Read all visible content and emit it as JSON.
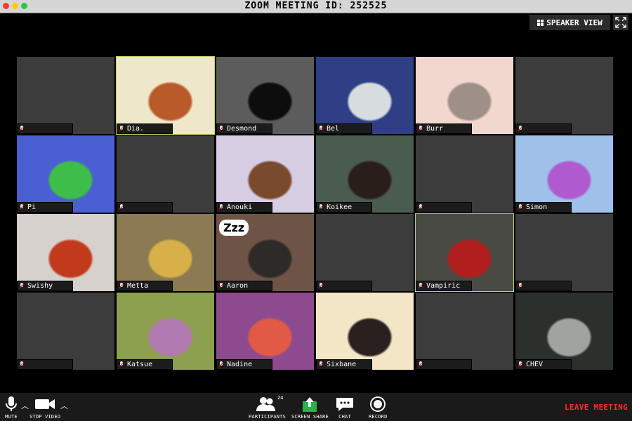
{
  "window": {
    "title": "ZOOM MEETING ID: 252525"
  },
  "top_controls": {
    "speaker_view_label": "SPEAKER VIEW"
  },
  "participants": [
    {
      "name": "",
      "has_video": false
    },
    {
      "name": "Dia.",
      "has_video": true,
      "bg": "#efe7c9",
      "fg": "#b85a2a",
      "active": true
    },
    {
      "name": "Desmond",
      "has_video": true,
      "bg": "#5c5c5c",
      "fg": "#0d0d0d"
    },
    {
      "name": "Bel",
      "has_video": true,
      "bg": "#2f3f86",
      "fg": "#d7dcde"
    },
    {
      "name": "Burr",
      "has_video": true,
      "bg": "#f1d7cd",
      "fg": "#9e9088"
    },
    {
      "name": "",
      "has_video": false
    },
    {
      "name": "Pi",
      "has_video": true,
      "bg": "#4a5fd1",
      "fg": "#3fbd4a"
    },
    {
      "name": "",
      "has_video": false
    },
    {
      "name": "Anouki",
      "has_video": true,
      "bg": "#d7cde3",
      "fg": "#7a4a2e"
    },
    {
      "name": "Koikee",
      "has_video": true,
      "bg": "#4a5b50",
      "fg": "#2a1e1a"
    },
    {
      "name": "",
      "has_video": false
    },
    {
      "name": "Simon",
      "has_video": true,
      "bg": "#9fc0e8",
      "fg": "#b05ad0"
    },
    {
      "name": "Swishy",
      "has_video": true,
      "bg": "#d6d1cc",
      "fg": "#c23a1c"
    },
    {
      "name": "Metta",
      "has_video": true,
      "bg": "#8b7a52",
      "fg": "#d8b04a"
    },
    {
      "name": "Aaron",
      "has_video": true,
      "bg": "#6e5446",
      "fg": "#2e2a28",
      "zzz": "Zzz"
    },
    {
      "name": "",
      "has_video": false
    },
    {
      "name": "Vampiric",
      "has_video": true,
      "bg": "#4a4a44",
      "fg": "#b01e1e",
      "active": true
    },
    {
      "name": "",
      "has_video": false
    },
    {
      "name": "",
      "has_video": false
    },
    {
      "name": "Katsue",
      "has_video": true,
      "bg": "#8da04f",
      "fg": "#b07ab0"
    },
    {
      "name": "Nadine",
      "has_video": true,
      "bg": "#8e4a8e",
      "fg": "#e05a45"
    },
    {
      "name": "Sixbane",
      "has_video": true,
      "bg": "#f2e6c6",
      "fg": "#2a2020"
    },
    {
      "name": "",
      "has_video": false
    },
    {
      "name": "CHEV",
      "has_video": true,
      "bg": "#2c302c",
      "fg": "#a0a4a0"
    }
  ],
  "toolbar": {
    "mute": "MUTE",
    "stop_video": "STOP VIDEO",
    "participants": "PARTICIPANTS",
    "participants_count": "24",
    "screen_share": "SCREEN SHARE",
    "chat": "CHAT",
    "record": "RECORD",
    "leave": "LEAVE MEETING"
  },
  "colors": {
    "leave": "#ff2a2a",
    "active_border": "#b9d36a",
    "share_green": "#27b34a"
  }
}
